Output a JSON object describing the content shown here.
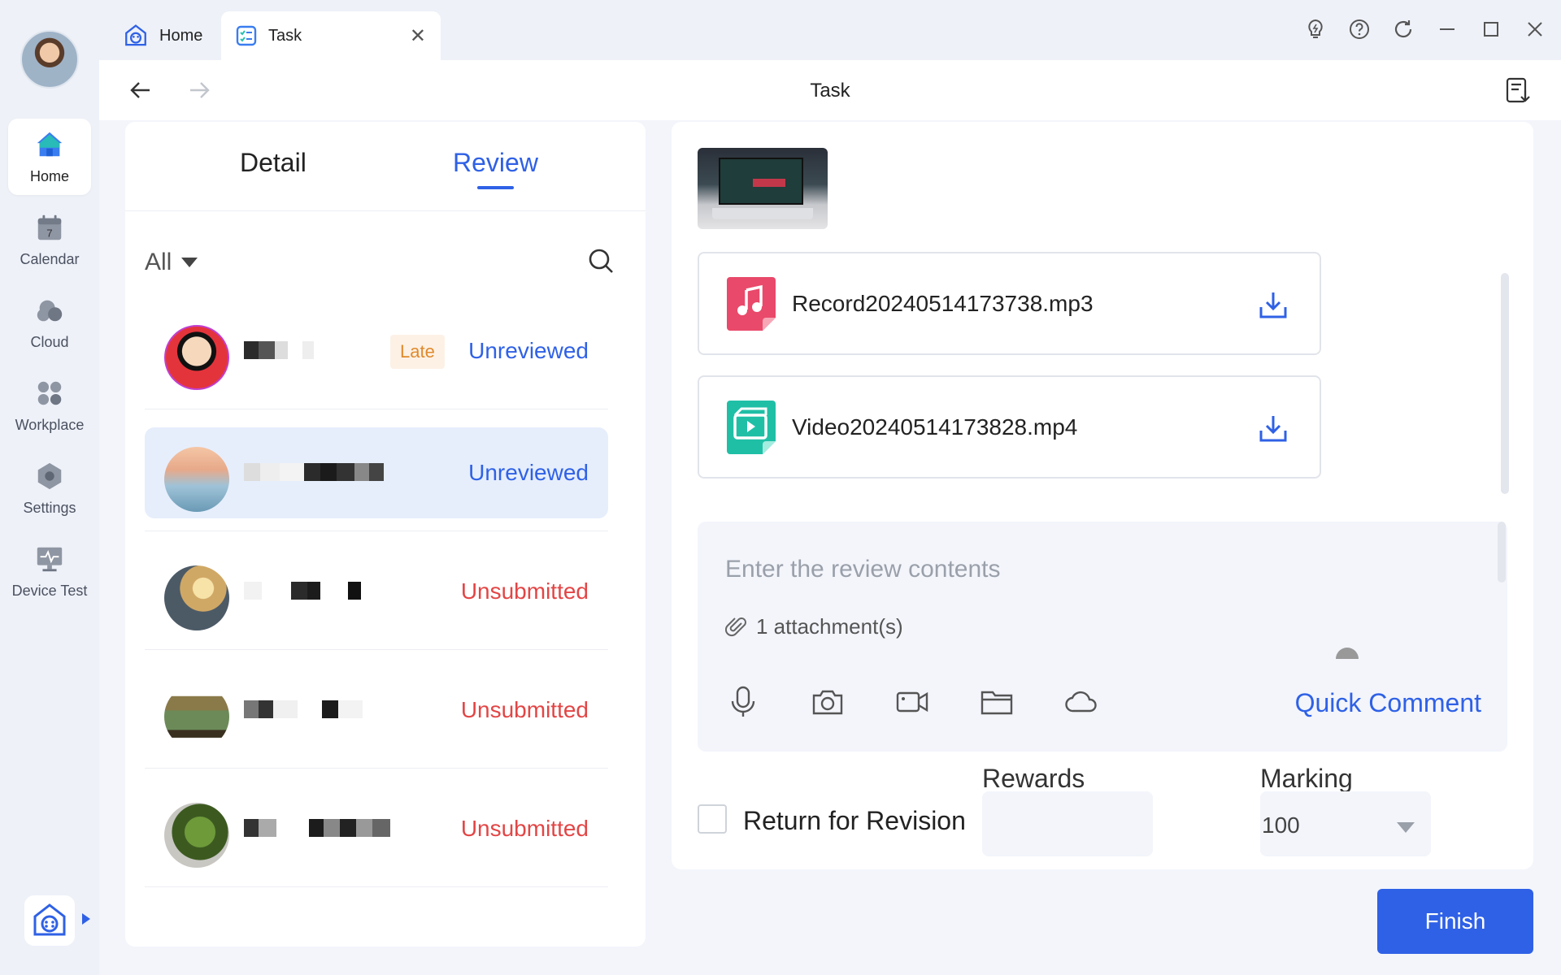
{
  "rail": {
    "items": [
      {
        "label": "Home",
        "icon": "home-icon"
      },
      {
        "label": "Calendar",
        "icon": "calendar-icon",
        "badge": "7"
      },
      {
        "label": "Cloud",
        "icon": "cloud-icon"
      },
      {
        "label": "Workplace",
        "icon": "workplace-icon"
      },
      {
        "label": "Settings",
        "icon": "settings-icon"
      },
      {
        "label": "Device Test",
        "icon": "device-test-icon"
      }
    ]
  },
  "tabs": {
    "home": "Home",
    "task": "Task",
    "close": "✕"
  },
  "nav": {
    "title": "Task"
  },
  "panel": {
    "tab_detail": "Detail",
    "tab_review": "Review",
    "filter": "All",
    "rows": [
      {
        "badge": "Late",
        "status": "Unreviewed",
        "status_type": "unreviewed"
      },
      {
        "badge": "",
        "status": "Unreviewed",
        "status_type": "unreviewed",
        "selected": true
      },
      {
        "badge": "",
        "status": "Unsubmitted",
        "status_type": "unsubmitted"
      },
      {
        "badge": "",
        "status": "Unsubmitted",
        "status_type": "unsubmitted"
      },
      {
        "badge": "",
        "status": "Unsubmitted",
        "status_type": "unsubmitted"
      }
    ]
  },
  "files": [
    {
      "name": "Record20240514173738.mp3",
      "icon": "music-file-icon",
      "color": "#e9496a"
    },
    {
      "name": "Video20240514173828.mp4",
      "icon": "video-file-icon",
      "color": "#1fbfa6"
    }
  ],
  "review": {
    "placeholder": "Enter the review contents",
    "attachments": "1 attachment(s)",
    "quick_comment": "Quick Comment"
  },
  "grading": {
    "return_label": "Return for Revision",
    "rewards_label": "Rewards",
    "marking_label": "Marking",
    "marking_value": "100"
  },
  "finish": "Finish",
  "colors": {
    "accent": "#2f61e6",
    "unsubmitted": "#e34545",
    "late_text": "#e08a2c"
  }
}
